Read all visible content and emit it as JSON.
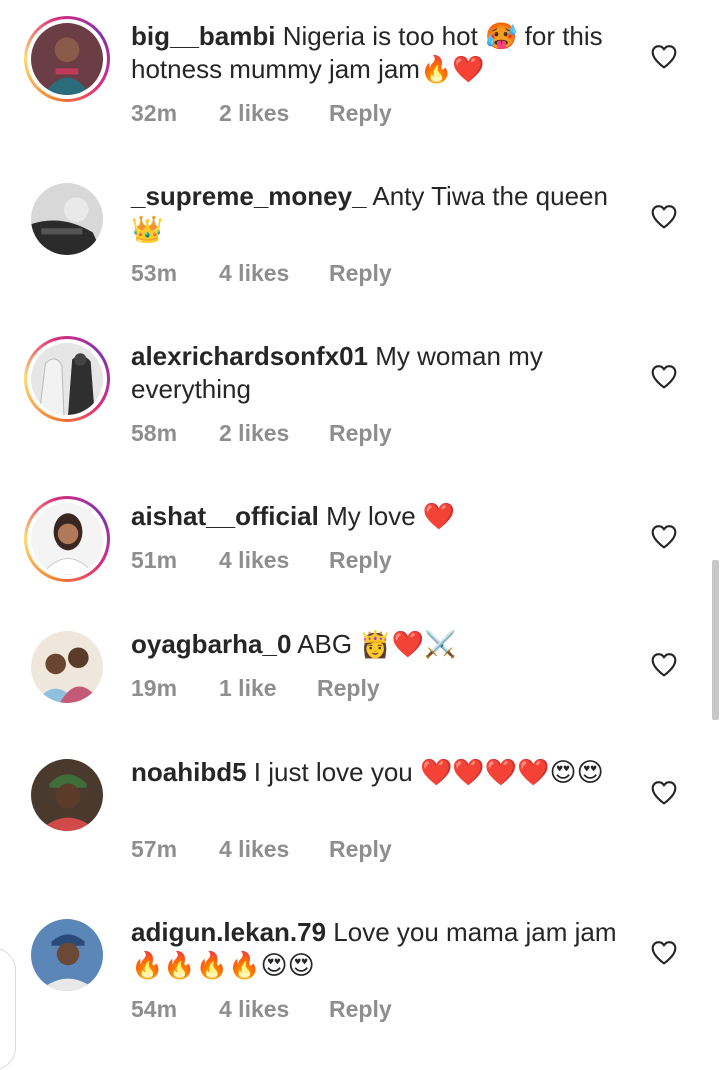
{
  "comments": [
    {
      "username": "big__bambi",
      "text": " Nigeria is too hot 🥵 for this hotness mummy jam jam🔥❤️",
      "time": "32m",
      "likes": "2 likes",
      "reply": "Reply"
    },
    {
      "username": "_supreme_money_",
      "text": " Anty Tiwa the queen 👑",
      "time": "53m",
      "likes": "4 likes",
      "reply": "Reply"
    },
    {
      "username": "alexrichardsonfx01",
      "text": " My woman my everything",
      "time": "58m",
      "likes": "2 likes",
      "reply": "Reply"
    },
    {
      "username": "aishat__official",
      "text": " My love ❤️",
      "time": "51m",
      "likes": "4 likes",
      "reply": "Reply"
    },
    {
      "username": "oyagbarha_0",
      "text": " ABG 👸❤️⚔️",
      "time": "19m",
      "likes": "1 like",
      "reply": "Reply"
    },
    {
      "username": "noahibd5",
      "text": " I just love you ❤️❤️❤️❤️😍😍",
      "time": "57m",
      "likes": "4 likes",
      "reply": "Reply"
    },
    {
      "username": "adigun.lekan.79",
      "text": " Love you mama jam jam 🔥🔥🔥🔥😍😍",
      "time": "54m",
      "likes": "4 likes",
      "reply": "Reply"
    }
  ],
  "icons": {
    "like": "heart-outline-icon"
  },
  "colors": {
    "primary_text": "#262626",
    "secondary_text": "#8e8e8e",
    "story_ring_start": "#f58529",
    "story_ring_end": "#dd2a7b"
  }
}
